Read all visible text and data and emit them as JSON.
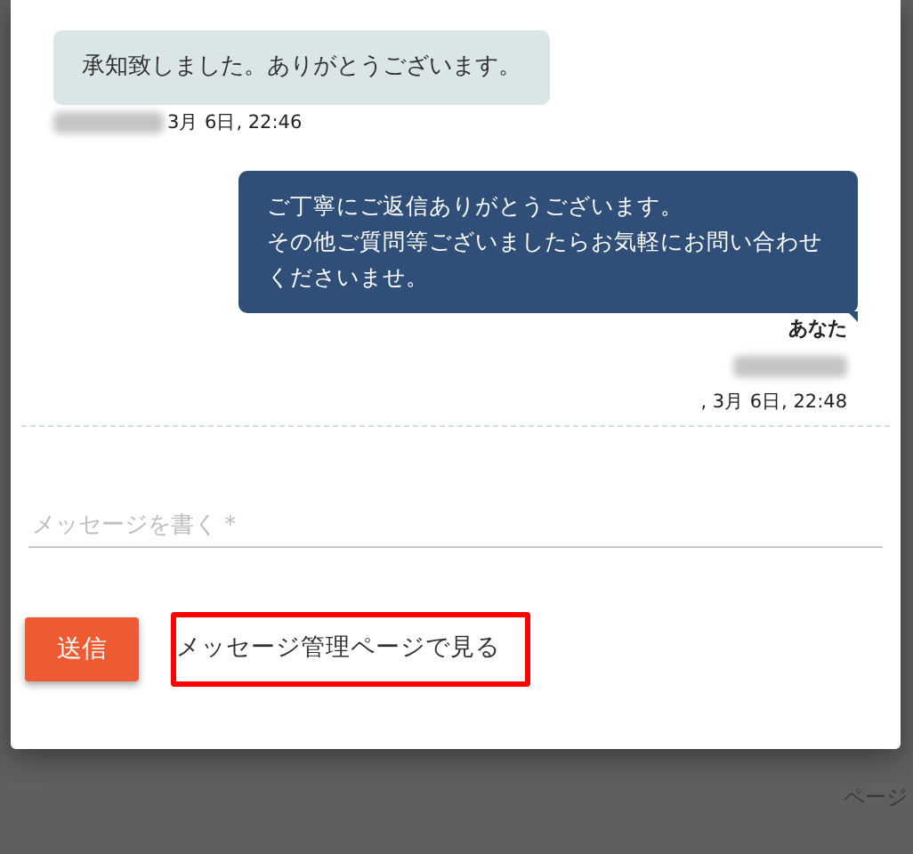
{
  "messages": [
    {
      "kind": "received",
      "text": "承知致しました。ありがとうございます。",
      "timestamp": "3月 6日, 22:46"
    },
    {
      "kind": "sent",
      "lines": [
        "ご丁寧にご返信ありがとうございます。",
        "その他ご質問等ございましたらお気軽にお問い合わせくださいませ。"
      ],
      "sender": "あなた",
      "timestamp": ", 3月 6日, 22:48"
    }
  ],
  "composer": {
    "placeholder": "メッセージを書く *"
  },
  "send_button": "送信",
  "manage_link": "メッセージ管理ページで見る",
  "background_text": "ページ"
}
